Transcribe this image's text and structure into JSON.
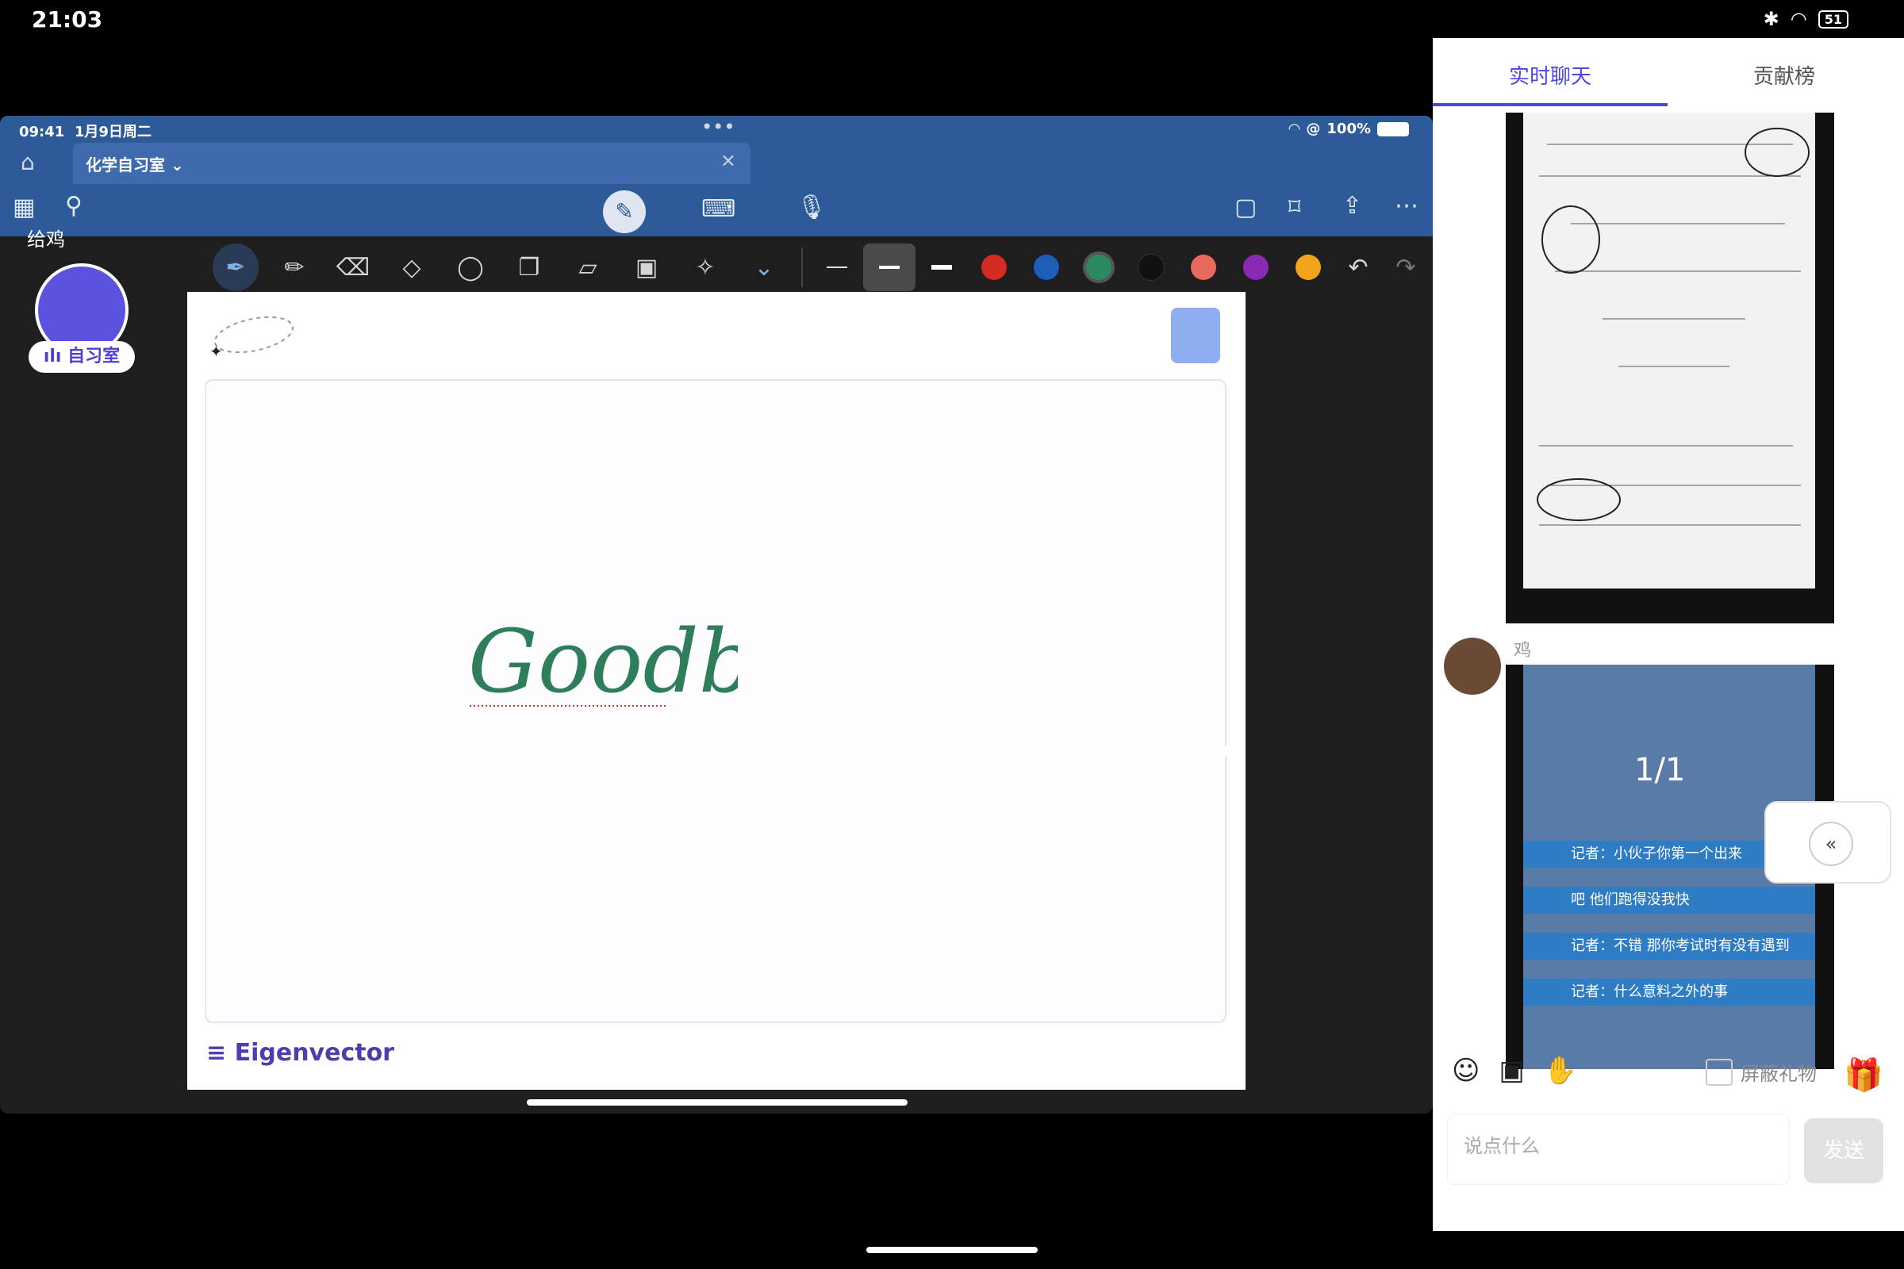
{
  "system": {
    "time": "21:03",
    "battery": "51"
  },
  "ipad": {
    "time": "09:41",
    "date": "1月9日周二",
    "dots": "•••",
    "battery_pct": "100%",
    "tab_title": "化学自习室",
    "tab_close": "×",
    "gift_label": "给鸡"
  },
  "room": {
    "badge": "自习室"
  },
  "canvas": {
    "handwriting": "Goodbye!",
    "logo": "Eigenvector"
  },
  "colors": {
    "swatches": [
      "#d62b22",
      "#1e5db8",
      "#2a8a5e",
      "#111111",
      "#e86a5e",
      "#8a2ab4",
      "#f2a51a"
    ],
    "accent": "#4d47e0",
    "ipad_top": "#2d5a98"
  },
  "chat": {
    "tabs": [
      {
        "label": "实时聊天"
      },
      {
        "label": "贡献榜"
      }
    ],
    "sender": "鸡",
    "img2_label": "1/1",
    "news": [
      "记者：小伙子你第一个出来",
      "吧 他们跑得没我快",
      "记者：不错 那你考试时有没有遇到",
      "记者：什么意料之外的事"
    ],
    "block_gift": "屏蔽礼物",
    "placeholder": "说点什么",
    "send": "发送"
  }
}
